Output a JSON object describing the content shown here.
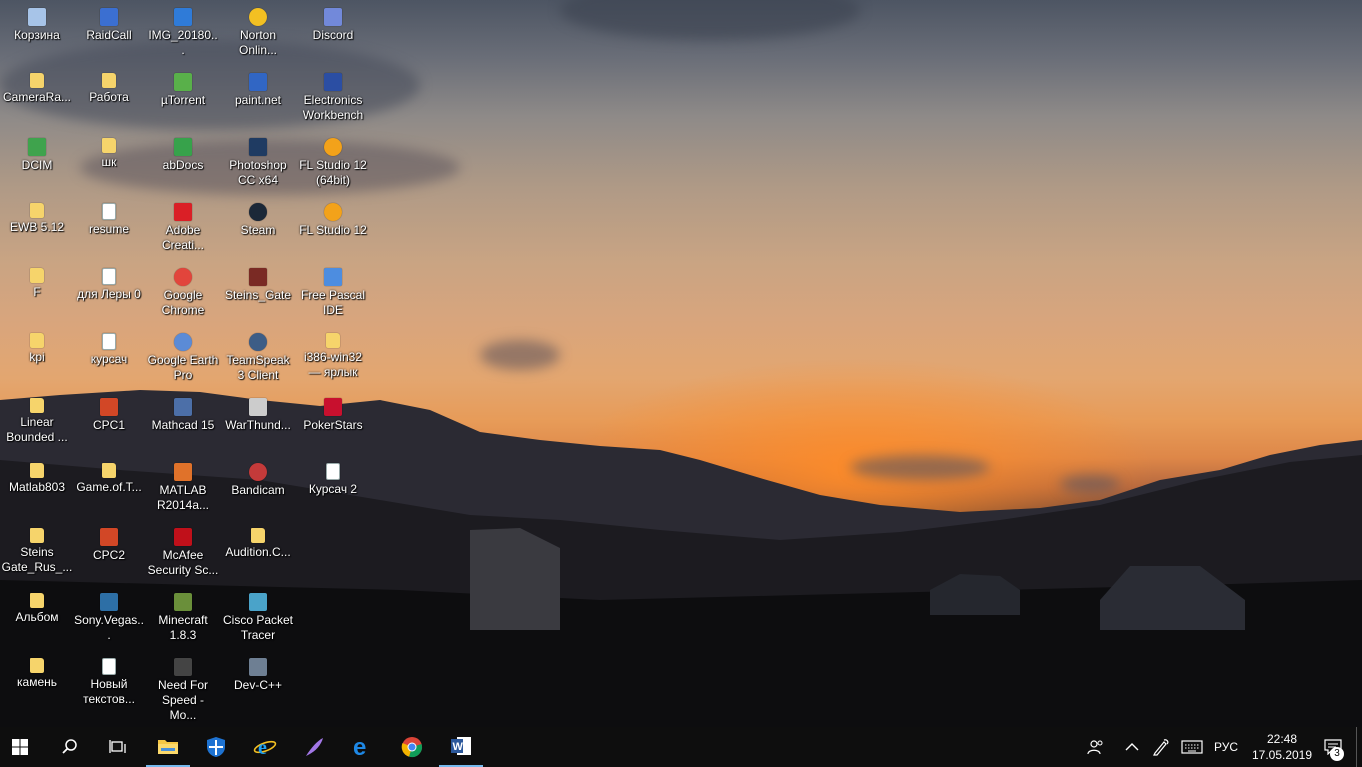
{
  "desktop": {
    "icons": [
      {
        "label": "Корзина",
        "icon": "recycle-bin-icon",
        "color": "#a7c4e8",
        "type": "app"
      },
      {
        "label": "CameraRa...",
        "icon": "folder-icon",
        "color": "#f6d46b",
        "type": "folder"
      },
      {
        "label": "DCIM",
        "icon": "tree-icon",
        "color": "#3fa34d",
        "type": "app"
      },
      {
        "label": "EWB 5.12",
        "icon": "folder-icon",
        "color": "#f6d46b",
        "type": "folder"
      },
      {
        "label": "F",
        "icon": "folder-icon",
        "color": "#f6d46b",
        "type": "folder"
      },
      {
        "label": "kpi",
        "icon": "folder-icon",
        "color": "#f6d46b",
        "type": "folder"
      },
      {
        "label": "Linear Bounded ...",
        "icon": "folder-icon",
        "color": "#f6d46b",
        "type": "folder"
      },
      {
        "label": "Matlab803",
        "icon": "folder-icon",
        "color": "#f6d46b",
        "type": "folder"
      },
      {
        "label": "Steins Gate_Rus_...",
        "icon": "folder-icon",
        "color": "#f6d46b",
        "type": "folder"
      },
      {
        "label": "Альбом",
        "icon": "folder-icon",
        "color": "#f6d46b",
        "type": "folder"
      },
      {
        "label": "камень",
        "icon": "folder-icon",
        "color": "#f6d46b",
        "type": "folder"
      },
      {
        "label": "RaidCall",
        "icon": "raidcall-icon",
        "color": "#3b6fd1",
        "type": "app"
      },
      {
        "label": "Работа",
        "icon": "folder-icon",
        "color": "#f6d46b",
        "type": "folder"
      },
      {
        "label": "шк",
        "icon": "folder-icon",
        "color": "#f6d46b",
        "type": "folder"
      },
      {
        "label": "resume",
        "icon": "document-icon",
        "color": "#ffffff",
        "type": "doc"
      },
      {
        "label": "для Леры 0",
        "icon": "document-icon",
        "color": "#ffffff",
        "type": "doc"
      },
      {
        "label": "курсач",
        "icon": "document-icon",
        "color": "#ffffff",
        "type": "doc"
      },
      {
        "label": "CPC1",
        "icon": "powerpoint-icon",
        "color": "#d24726",
        "type": "app"
      },
      {
        "label": "Game.of.T...",
        "icon": "folder-icon",
        "color": "#f6d46b",
        "type": "folder"
      },
      {
        "label": "CPC2",
        "icon": "powerpoint-icon",
        "color": "#d24726",
        "type": "app"
      },
      {
        "label": "Sony.Vegas...",
        "icon": "video-icon",
        "color": "#2d6fa6",
        "type": "app"
      },
      {
        "label": "Новый текстов...",
        "icon": "document-icon",
        "color": "#ffffff",
        "type": "doc"
      },
      {
        "label": "IMG_20180...",
        "icon": "image-file-icon",
        "color": "#2f7bd8",
        "type": "app"
      },
      {
        "label": "µTorrent",
        "icon": "utorrent-icon",
        "color": "#59b04a",
        "type": "app"
      },
      {
        "label": "abDocs",
        "icon": "abdocs-icon",
        "color": "#37a24b",
        "type": "app"
      },
      {
        "label": "Adobe Creati...",
        "icon": "adobe-creative-cloud-icon",
        "color": "#da1f26",
        "type": "app"
      },
      {
        "label": "Google Chrome",
        "icon": "chrome-icon",
        "color": "#e2453c",
        "type": "round"
      },
      {
        "label": "Google Earth Pro",
        "icon": "google-earth-icon",
        "color": "#5b8bd6",
        "type": "round"
      },
      {
        "label": "Mathcad 15",
        "icon": "mathcad-icon",
        "color": "#4c6fa8",
        "type": "app"
      },
      {
        "label": "MATLAB R2014a...",
        "icon": "matlab-icon",
        "color": "#e0722a",
        "type": "app"
      },
      {
        "label": "McAfee Security Sc...",
        "icon": "mcafee-icon",
        "color": "#c0101a",
        "type": "app"
      },
      {
        "label": "Minecraft 1.8.3",
        "icon": "minecraft-icon",
        "color": "#6a8f3a",
        "type": "app"
      },
      {
        "label": "Need For Speed - Mo...",
        "icon": "nfs-icon",
        "color": "#444444",
        "type": "app"
      },
      {
        "label": "Norton Onlin...",
        "icon": "norton-icon",
        "color": "#f3c022",
        "type": "round"
      },
      {
        "label": "paint.net",
        "icon": "paintnet-icon",
        "color": "#3166c4",
        "type": "app"
      },
      {
        "label": "Photoshop CC x64",
        "icon": "photoshop-icon",
        "color": "#1f3b62",
        "type": "app"
      },
      {
        "label": "Steam",
        "icon": "steam-icon",
        "color": "#1b2838",
        "type": "round"
      },
      {
        "label": "Steins_Gate",
        "icon": "steins-gate-icon",
        "color": "#7a2a24",
        "type": "app"
      },
      {
        "label": "TeamSpeak 3 Client",
        "icon": "teamspeak-icon",
        "color": "#3d5d86",
        "type": "round"
      },
      {
        "label": "WarThund...",
        "icon": "warthunder-icon",
        "color": "#cccccc",
        "type": "app"
      },
      {
        "label": "Bandicam",
        "icon": "bandicam-icon",
        "color": "#c43a3a",
        "type": "round"
      },
      {
        "label": "Audition.C...",
        "icon": "folder-icon",
        "color": "#f6d46b",
        "type": "folder"
      },
      {
        "label": "Cisco Packet Tracer",
        "icon": "cisco-packet-tracer-icon",
        "color": "#4aa3c9",
        "type": "app"
      },
      {
        "label": "Dev-C++",
        "icon": "devcpp-icon",
        "color": "#6e7f93",
        "type": "app"
      },
      {
        "label": "Discord",
        "icon": "discord-icon",
        "color": "#7289da",
        "type": "app"
      },
      {
        "label": "Electronics Workbench",
        "icon": "electronics-workbench-icon",
        "color": "#2b4ea3",
        "type": "app"
      },
      {
        "label": "FL Studio 12 (64bit)",
        "icon": "fl-studio-icon",
        "color": "#f3a21a",
        "type": "round"
      },
      {
        "label": "FL Studio 12",
        "icon": "fl-studio-icon",
        "color": "#f3a21a",
        "type": "round"
      },
      {
        "label": "Free Pascal IDE",
        "icon": "free-pascal-icon",
        "color": "#4d8de0",
        "type": "app"
      },
      {
        "label": "i386-win32 — ярлык",
        "icon": "folder-shortcut-icon",
        "color": "#f6d46b",
        "type": "folder"
      },
      {
        "label": "PokerStars",
        "icon": "pokerstars-icon",
        "color": "#c8102e",
        "type": "app"
      },
      {
        "label": "Курсач 2",
        "icon": "document-icon",
        "color": "#ffffff",
        "type": "doc"
      }
    ]
  },
  "taskbar": {
    "buttons": [
      {
        "name": "start-button",
        "icon": "windows-logo-icon"
      },
      {
        "name": "search-button",
        "icon": "search-icon"
      },
      {
        "name": "task-view-button",
        "icon": "task-view-icon"
      },
      {
        "name": "file-explorer-button",
        "icon": "folder-icon"
      },
      {
        "name": "windows-defender-button",
        "icon": "shield-icon"
      },
      {
        "name": "internet-explorer-button",
        "icon": "internet-explorer-icon"
      },
      {
        "name": "feather-app-button",
        "icon": "feather-icon"
      },
      {
        "name": "edge-button",
        "icon": "edge-icon"
      },
      {
        "name": "chrome-button",
        "icon": "chrome-icon"
      },
      {
        "name": "word-button",
        "icon": "word-icon"
      }
    ],
    "tray": {
      "language": "РУС",
      "time": "22:48",
      "date": "17.05.2019",
      "notifications_count": "3"
    }
  }
}
